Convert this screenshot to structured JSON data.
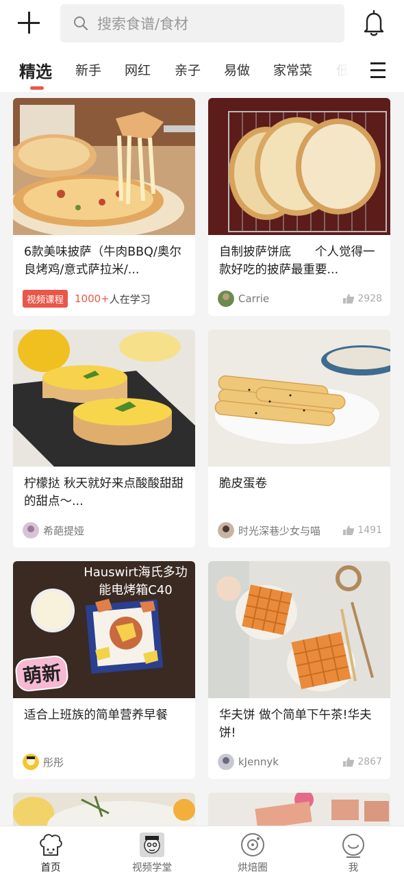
{
  "header": {
    "search_placeholder": "搜索食谱/食材"
  },
  "tabs": [
    "精选",
    "新手",
    "网红",
    "亲子",
    "易做",
    "家常菜",
    "低"
  ],
  "cards": [
    {
      "title": "6款美味披萨（牛肉BBQ/奥尔良烤鸡/意式萨拉米/...",
      "badge": "视频课程",
      "learners_count": "1000+",
      "learners_text": "人在学习"
    },
    {
      "title": "自制披萨饼底　　个人觉得一款好吃的披萨最重要...",
      "author": "Carrie",
      "likes": "2928"
    },
    {
      "title": "柠檬挞  秋天就好来点酸酸甜甜的甜点～...",
      "author": "希葩提娅"
    },
    {
      "title": "脆皮蛋卷",
      "author": "时光深巷少女与喵",
      "likes": "1491"
    },
    {
      "title": "适合上班族的简单营养早餐",
      "author": "彤彤",
      "image_text_1": "Hauswirt海氏多功",
      "image_text_2": "能电烤箱C40",
      "image_sticker": "萌新"
    },
    {
      "title": "华夫饼  做个简单下午茶!华夫饼!",
      "author": "kJennyk",
      "likes": "2867"
    }
  ],
  "bottom_nav": [
    {
      "label": "首页",
      "icon": "chef-hat-icon",
      "active": true
    },
    {
      "label": "视频学堂",
      "icon": "video-school-icon",
      "active": false
    },
    {
      "label": "烘焙圈",
      "icon": "baking-circle-icon",
      "active": false
    },
    {
      "label": "我",
      "icon": "profile-icon",
      "active": false
    }
  ],
  "colors": {
    "accent": "#e9574a",
    "background": "#f4f4f4"
  }
}
